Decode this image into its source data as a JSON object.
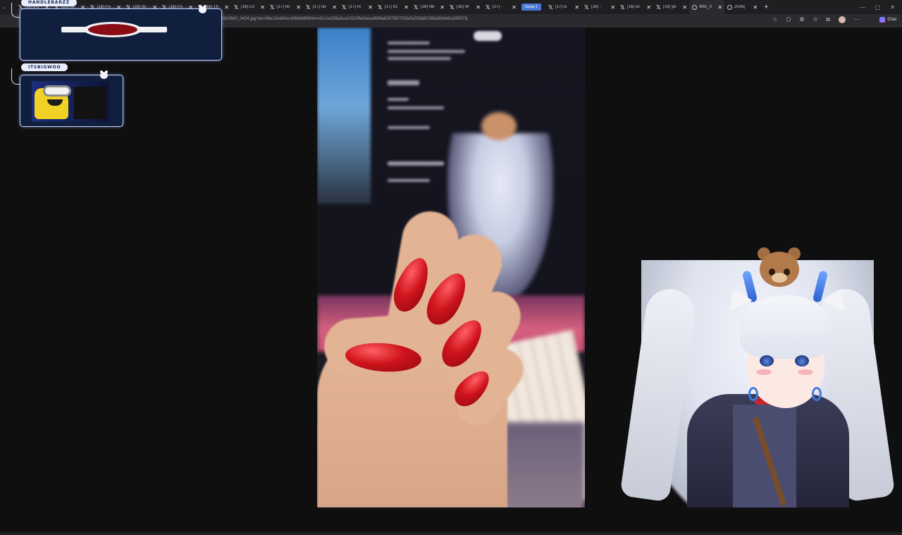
{
  "browser": {
    "tabs": [
      {
        "label": "(10) Po",
        "icon": "x-logo-icon"
      },
      {
        "label": "(16) Sc",
        "icon": "x-logo-icon"
      },
      {
        "label": "(16) Fo",
        "icon": "x-logo-icon"
      },
      {
        "label": "(16) Sc",
        "icon": "x-logo-icon"
      },
      {
        "label": "(16) Fo",
        "icon": "x-logo-icon"
      },
      {
        "label": "(16) Th",
        "icon": "x-logo-icon"
      },
      {
        "label": "(16) LU",
        "icon": "x-logo-icon"
      },
      {
        "label": "(17) no",
        "icon": "x-logo-icon"
      },
      {
        "label": "(17) no",
        "icon": "x-logo-icon"
      },
      {
        "label": "(17) Al",
        "icon": "x-logo-icon"
      },
      {
        "label": "(17) IG",
        "icon": "x-logo-icon"
      },
      {
        "label": "(18) Ne",
        "icon": "x-logo-icon"
      },
      {
        "label": "(16) W",
        "icon": "x-logo-icon"
      },
      {
        "label": "(17) -",
        "icon": "x-logo-icon"
      },
      {
        "label": "(17) is",
        "icon": "x-logo-icon"
      },
      {
        "label": "(16) -",
        "icon": "x-logo-icon"
      },
      {
        "label": "(16) Di",
        "icon": "x-logo-icon"
      },
      {
        "label": "(16) ye",
        "icon": "x-logo-icon"
      },
      {
        "label": "IMG_0",
        "icon": "globe-icon"
      },
      {
        "label": "2026(",
        "icon": "globe-icon"
      }
    ],
    "group_label": "Group 1",
    "url": "062/IMG_0424.jpg?ex=69e12eef&is=69dfdd6f&hm=42c1e228a3ca102245e2eced938a62678f271f3e5c02bd82268a924e5cd35f07&",
    "chat_label": "Chat",
    "new_tab_symbol": "+",
    "window_controls": [
      "—",
      "▢",
      "✕"
    ]
  },
  "overlay": {
    "chat_user_1": "HANDLEBARZZ",
    "chat_user_2": "ITSBIGWOO"
  },
  "colors": {
    "accent": "#4a78d8",
    "nail_red": "#d0141c",
    "chat_bg": "#0f1f3d"
  }
}
